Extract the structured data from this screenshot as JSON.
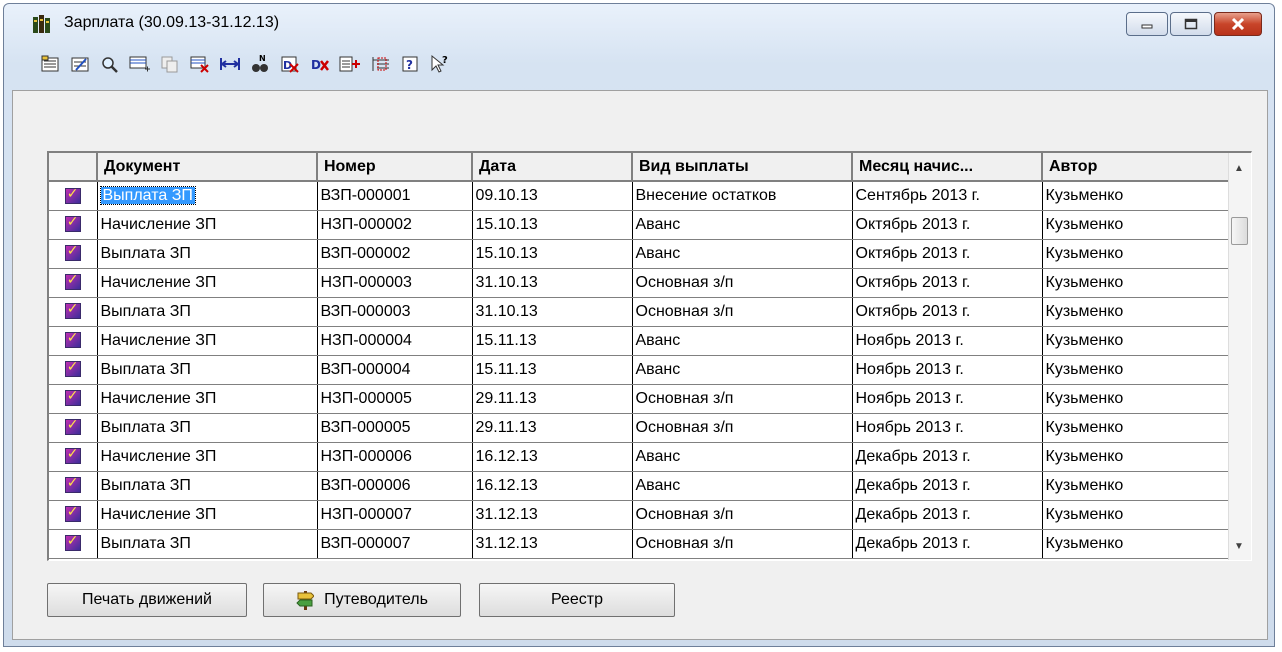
{
  "window": {
    "title": "Зарплата (30.09.13-31.12.13)"
  },
  "toolbar": {
    "icons": [
      "new-doc-icon",
      "edit-doc-icon",
      "find-icon",
      "add-row-icon",
      "copy-icon",
      "delete-icon",
      "interval-icon",
      "search-binoculars-icon",
      "unpost-icon",
      "delete-mark-icon",
      "post-icon",
      "register-icon",
      "help-icon",
      "whats-this-icon"
    ]
  },
  "table": {
    "columns": [
      "Документ",
      "Номер",
      "Дата",
      "Вид выплаты",
      "Месяц начис...",
      "Автор"
    ],
    "rows": [
      [
        "Выплата ЗП",
        "ВЗП-000001",
        "09.10.13",
        "Внесение остатков",
        "Сентябрь 2013 г.",
        "Кузьменко"
      ],
      [
        "Начисление ЗП",
        "НЗП-000002",
        "15.10.13",
        "Аванс",
        "Октябрь 2013 г.",
        "Кузьменко"
      ],
      [
        "Выплата ЗП",
        "ВЗП-000002",
        "15.10.13",
        "Аванс",
        "Октябрь 2013 г.",
        "Кузьменко"
      ],
      [
        "Начисление ЗП",
        "НЗП-000003",
        "31.10.13",
        "Основная з/п",
        "Октябрь 2013 г.",
        "Кузьменко"
      ],
      [
        "Выплата ЗП",
        "ВЗП-000003",
        "31.10.13",
        "Основная з/п",
        "Октябрь 2013 г.",
        "Кузьменко"
      ],
      [
        "Начисление ЗП",
        "НЗП-000004",
        "15.11.13",
        "Аванс",
        "Ноябрь 2013 г.",
        "Кузьменко"
      ],
      [
        "Выплата ЗП",
        "ВЗП-000004",
        "15.11.13",
        "Аванс",
        "Ноябрь 2013 г.",
        "Кузьменко"
      ],
      [
        "Начисление ЗП",
        "НЗП-000005",
        "29.11.13",
        "Основная з/п",
        "Ноябрь 2013 г.",
        "Кузьменко"
      ],
      [
        "Выплата ЗП",
        "ВЗП-000005",
        "29.11.13",
        "Основная з/п",
        "Ноябрь 2013 г.",
        "Кузьменко"
      ],
      [
        "Начисление ЗП",
        "НЗП-000006",
        "16.12.13",
        "Аванс",
        "Декабрь 2013 г.",
        "Кузьменко"
      ],
      [
        "Выплата ЗП",
        "ВЗП-000006",
        "16.12.13",
        "Аванс",
        "Декабрь 2013 г.",
        "Кузьменко"
      ],
      [
        "Начисление ЗП",
        "НЗП-000007",
        "31.12.13",
        "Основная з/п",
        "Декабрь 2013 г.",
        "Кузьменко"
      ],
      [
        "Выплата ЗП",
        "ВЗП-000007",
        "31.12.13",
        "Основная з/п",
        "Декабрь 2013 г.",
        "Кузьменко"
      ]
    ]
  },
  "buttons": {
    "print_movements": "Печать движений",
    "guide": "Путеводитель",
    "registry": "Реестр"
  }
}
